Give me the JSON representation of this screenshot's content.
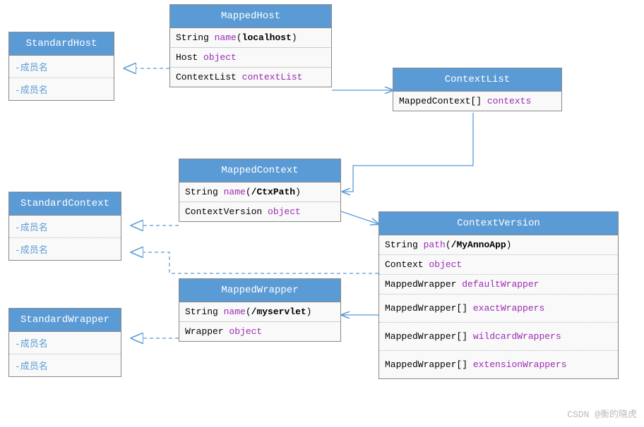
{
  "boxes": {
    "standardHost": {
      "title": "StandardHost",
      "members": [
        "-成员名",
        "-成员名"
      ]
    },
    "mappedHost": {
      "title": "MappedHost",
      "rows": [
        {
          "type": "String",
          "field": "name",
          "value": "localhost"
        },
        {
          "type": "Host",
          "field": "object"
        },
        {
          "type": "ContextList",
          "field": "contextList"
        }
      ]
    },
    "contextList": {
      "title": "ContextList",
      "rows": [
        {
          "type": "MappedContext[]",
          "field": "contexts"
        }
      ]
    },
    "standardContext": {
      "title": "StandardContext",
      "members": [
        "-成员名",
        "-成员名"
      ]
    },
    "mappedContext": {
      "title": "MappedContext",
      "rows": [
        {
          "type": "String",
          "field": "name",
          "value": "/CtxPath"
        },
        {
          "type": "ContextVersion",
          "field": "object"
        }
      ]
    },
    "contextVersion": {
      "title": "ContextVersion",
      "rows": [
        {
          "type": "String",
          "field": "path",
          "value": "/MyAnnoApp"
        },
        {
          "type": "Context",
          "field": "object"
        },
        {
          "type": "MappedWrapper",
          "field": "defaultWrapper"
        },
        {
          "type": "MappedWrapper[]",
          "field": "exactWrappers"
        },
        {
          "type": "MappedWrapper[]",
          "field": "wildcardWrappers"
        },
        {
          "type": "MappedWrapper[]",
          "field": "extensionWrappers"
        }
      ]
    },
    "standardWrapper": {
      "title": "StandardWrapper",
      "members": [
        "-成员名",
        "-成员名"
      ]
    },
    "mappedWrapper": {
      "title": "MappedWrapper",
      "rows": [
        {
          "type": "String",
          "field": "name",
          "value": "/myservlet"
        },
        {
          "type": "Wrapper",
          "field": "object"
        }
      ]
    }
  },
  "watermark": "CSDN @衡的晓虎"
}
